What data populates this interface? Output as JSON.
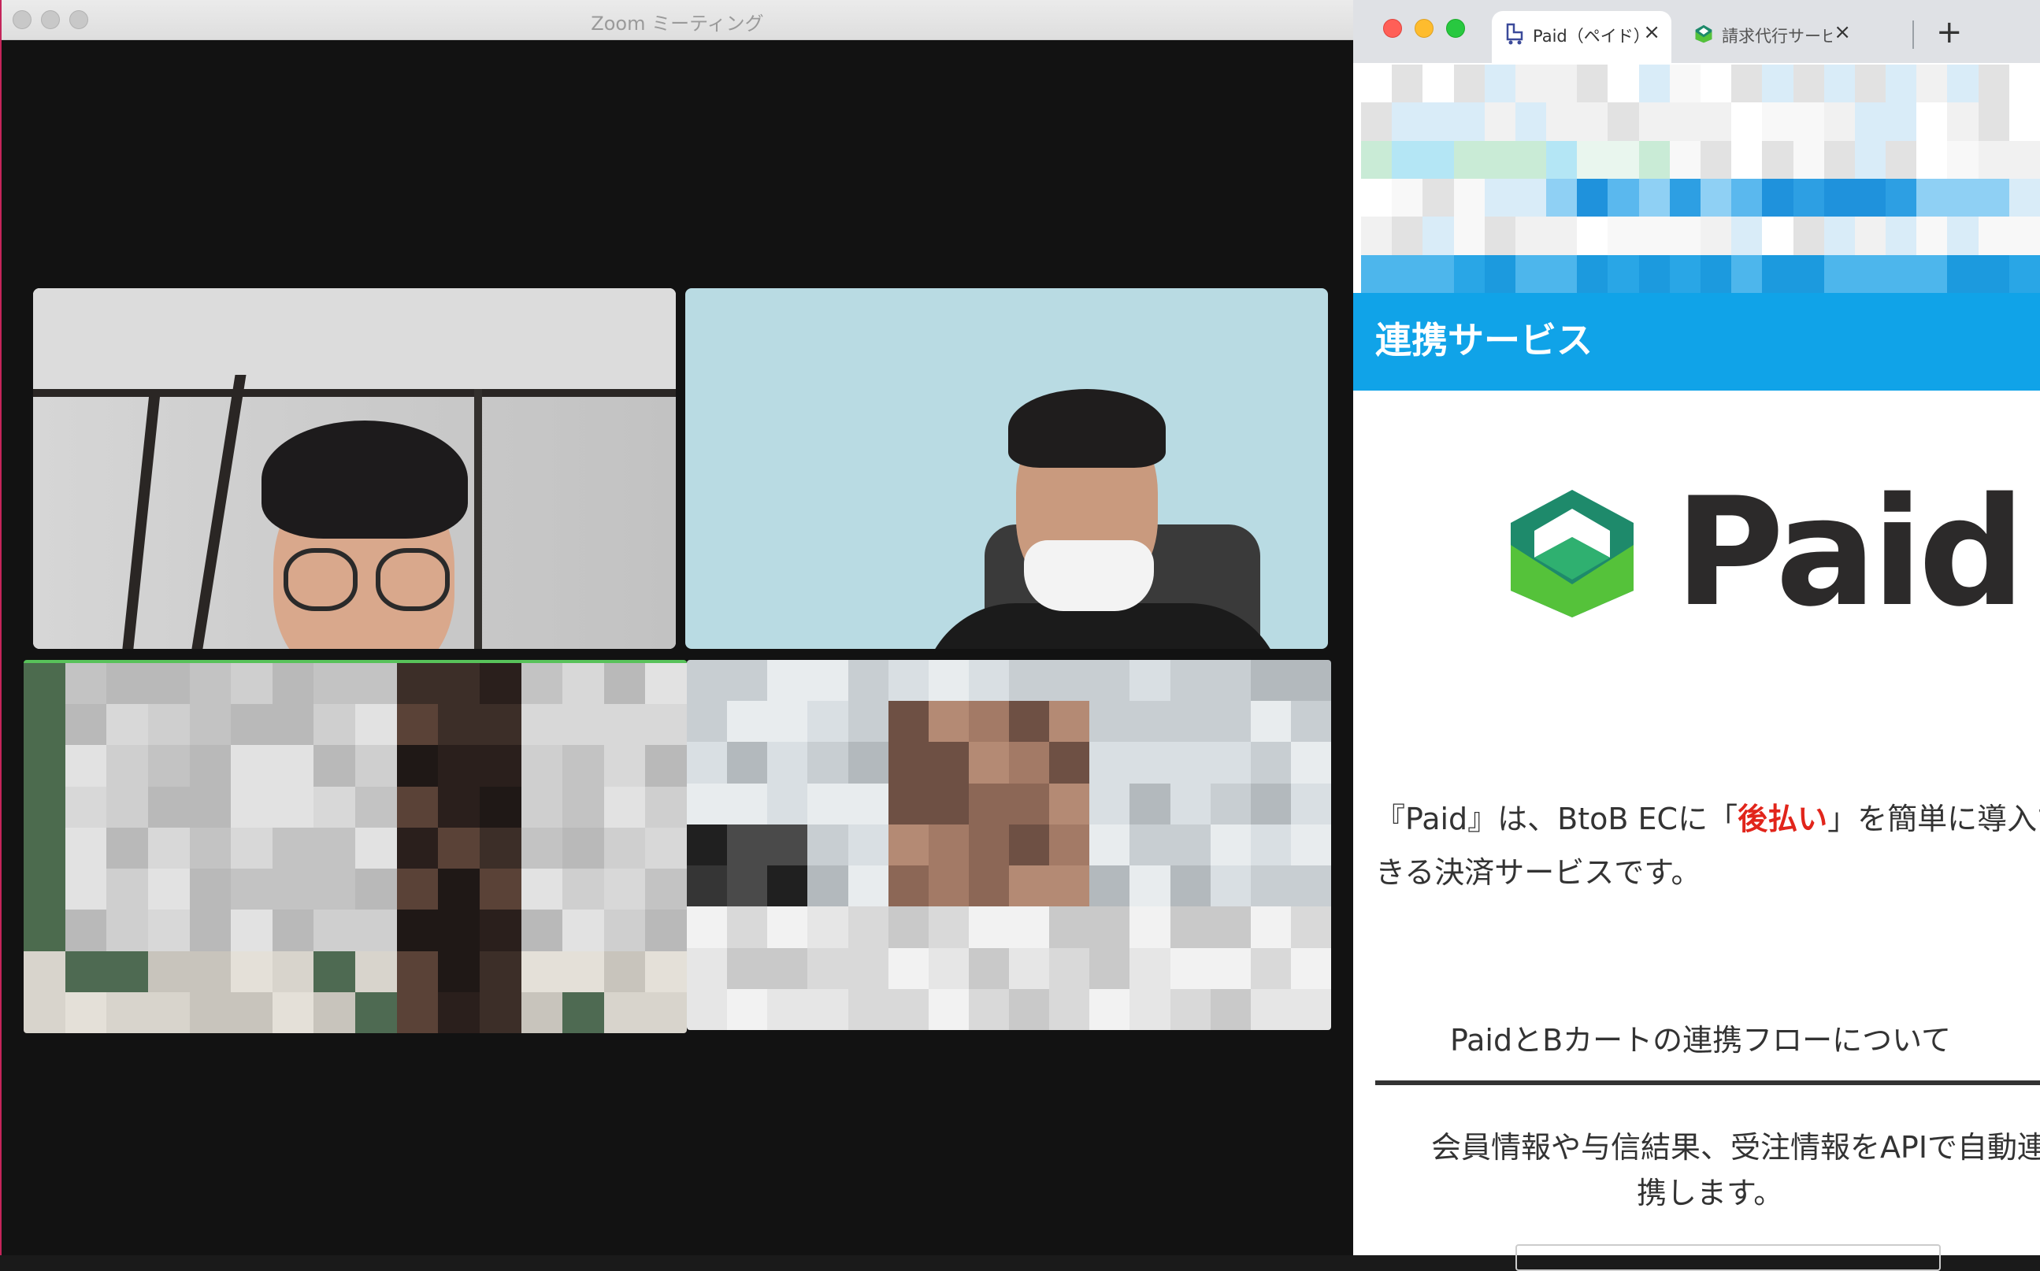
{
  "zoom": {
    "title": "Zoom ミーティング"
  },
  "browser": {
    "tabs": [
      {
        "label": "Paid（ペイド）",
        "close": "×"
      },
      {
        "label": "請求代行サービ",
        "close": "×"
      }
    ],
    "new_tab": "+",
    "banner_title": "連携サービス",
    "logo_word": "Paid",
    "description": {
      "part1": "『Paid』は、BtoB ECに「",
      "highlight": "後払い",
      "part2": "」を簡単に導入で",
      "line2": "きる決済サービスです。"
    },
    "flow": {
      "title": "PaidとBカートの連携フローについて",
      "line1": "会員情報や与信結果、受注情報をAPIで自動連",
      "line2": "携します。"
    },
    "colors": {
      "banner": "#10a3e8",
      "highlight": "#e1251b",
      "logo_green_dark": "#1e8a6b",
      "logo_green_light": "#55c23a"
    }
  }
}
